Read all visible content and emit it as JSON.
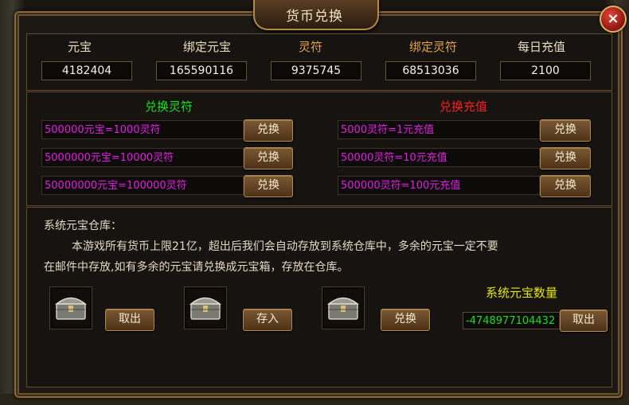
{
  "window": {
    "title": "货币兑换",
    "close_symbol": "×"
  },
  "currencies": [
    {
      "label": "元宝",
      "value": "4182404",
      "color": "#e9dcc0"
    },
    {
      "label": "绑定元宝",
      "value": "165590116",
      "color": "#e9dcc0"
    },
    {
      "label": "灵符",
      "value": "9375745",
      "color": "#e0a24a"
    },
    {
      "label": "绑定灵符",
      "value": "68513036",
      "color": "#e0a24a"
    },
    {
      "label": "每日充值",
      "value": "2100",
      "color": "#e9dcc0"
    }
  ],
  "exchange_lingfu": {
    "title": "兑换灵符",
    "rows": [
      {
        "text": "500000元宝=1000灵符",
        "button": "兑换"
      },
      {
        "text": "5000000元宝=10000灵符",
        "button": "兑换"
      },
      {
        "text": "50000000元宝=100000灵符",
        "button": "兑换"
      }
    ]
  },
  "exchange_recharge": {
    "title": "兑换充值",
    "rows": [
      {
        "text": "5000灵符=1元充值",
        "button": "兑换"
      },
      {
        "text": "50000灵符=10元充值",
        "button": "兑换"
      },
      {
        "text": "500000灵符=100元充值",
        "button": "兑换"
      }
    ]
  },
  "warehouse": {
    "title": "系统元宝仓库：",
    "line1": "本游戏所有货币上限21亿，超出后我们会自动存放到系统仓库中，多余的元宝一定不要",
    "line2": "在邮件中存放,如有多余的元宝请兑换成元宝箱，存放在仓库。",
    "take_button": "取出",
    "deposit_button": "存入",
    "exchange_button": "兑换",
    "count_label": "系统元宝数量",
    "count_value": "-4748977104432",
    "count_take_button": "取出"
  },
  "icons": {
    "chest": "treasure-chest-icon",
    "close": "close-icon"
  }
}
